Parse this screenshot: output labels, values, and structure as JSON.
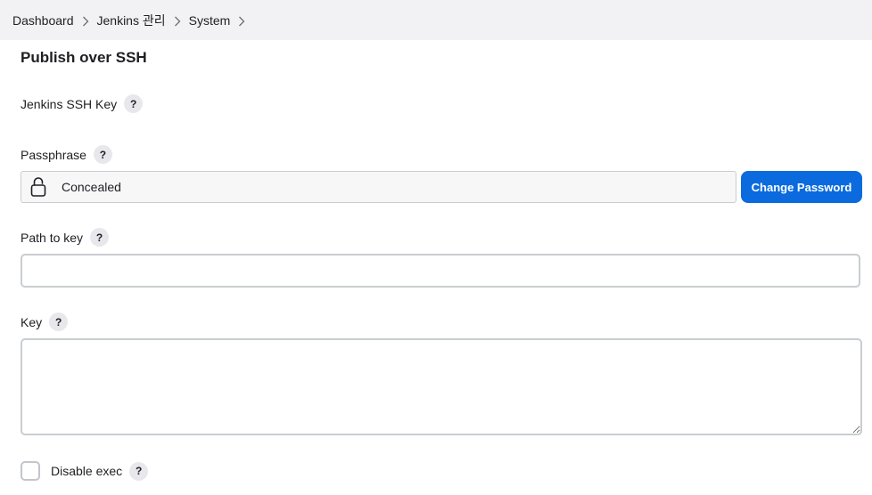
{
  "breadcrumb": {
    "items": [
      {
        "label": "Dashboard"
      },
      {
        "label": "Jenkins 관리"
      },
      {
        "label": "System"
      }
    ]
  },
  "section": {
    "title": "Publish over SSH"
  },
  "fields": {
    "jenkins_ssh_key": {
      "label": "Jenkins SSH Key",
      "help": "?"
    },
    "passphrase": {
      "label": "Passphrase",
      "help": "?",
      "value": "Concealed",
      "change_button": "Change Password"
    },
    "path_to_key": {
      "label": "Path to key",
      "help": "?",
      "value": ""
    },
    "key": {
      "label": "Key",
      "help": "?",
      "value": ""
    },
    "disable_exec": {
      "label": "Disable exec",
      "help": "?",
      "checked": false
    }
  },
  "colors": {
    "accent": "#0b6bde",
    "breadcrumb_bg": "#f2f2f5",
    "border": "#c9cdd0"
  },
  "icons": {
    "lock": "lock-icon",
    "chevron": "chevron-right-icon",
    "help": "help-icon"
  }
}
